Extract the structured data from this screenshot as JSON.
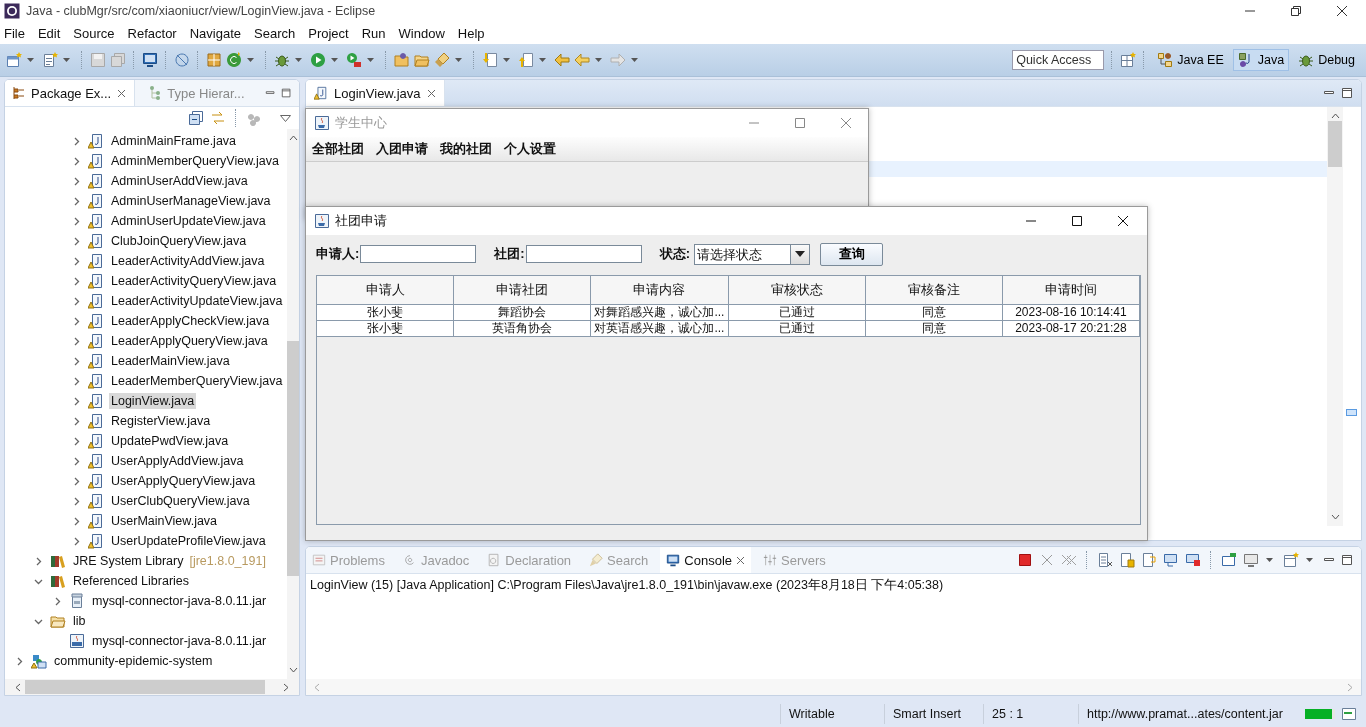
{
  "window": {
    "title": "Java - clubMgr/src/com/xiaoniucr/view/LoginView.java - Eclipse"
  },
  "menu": [
    "File",
    "Edit",
    "Source",
    "Refactor",
    "Navigate",
    "Search",
    "Project",
    "Run",
    "Window",
    "Help"
  ],
  "quick_access": {
    "placeholder": "Quick Access"
  },
  "perspectives": [
    {
      "label": "Java EE",
      "kind": "javaee",
      "selected": false
    },
    {
      "label": "Java",
      "kind": "java",
      "selected": true
    },
    {
      "label": "Debug",
      "kind": "debug",
      "selected": false
    }
  ],
  "package_explorer": {
    "tabs": [
      {
        "label": "Package Ex...",
        "selected": true
      },
      {
        "label": "Type Hierar...",
        "selected": false
      }
    ],
    "tree": [
      {
        "children": [
          {
            "children": [
              {
                "children": [
                  {
                    "label": "AdminMainFrame.java",
                    "kind": "java",
                    "expanded": false,
                    "selected": false
                  },
                  {
                    "label": "AdminMemberQueryView.java",
                    "kind": "java",
                    "expanded": false,
                    "selected": false
                  },
                  {
                    "label": "AdminUserAddView.java",
                    "kind": "java",
                    "expanded": false,
                    "selected": false
                  },
                  {
                    "label": "AdminUserManageView.java",
                    "kind": "java",
                    "expanded": false,
                    "selected": false
                  },
                  {
                    "label": "AdminUserUpdateView.java",
                    "kind": "java",
                    "expanded": false,
                    "selected": false
                  },
                  {
                    "label": "ClubJoinQueryView.java",
                    "kind": "java",
                    "expanded": false,
                    "selected": false
                  },
                  {
                    "label": "LeaderActivityAddView.java",
                    "kind": "java",
                    "expanded": false,
                    "selected": false
                  },
                  {
                    "label": "LeaderActivityQueryView.java",
                    "kind": "java",
                    "expanded": false,
                    "selected": false
                  },
                  {
                    "label": "LeaderActivityUpdateView.java",
                    "kind": "java",
                    "expanded": false,
                    "selected": false
                  },
                  {
                    "label": "LeaderApplyCheckView.java",
                    "kind": "java",
                    "expanded": false,
                    "selected": false
                  },
                  {
                    "label": "LeaderApplyQueryView.java",
                    "kind": "java",
                    "expanded": false,
                    "selected": false
                  },
                  {
                    "label": "LeaderMainView.java",
                    "kind": "java",
                    "expanded": false,
                    "selected": false
                  },
                  {
                    "label": "LeaderMemberQueryView.java",
                    "kind": "java",
                    "expanded": false,
                    "selected": false
                  },
                  {
                    "label": "LoginView.java",
                    "kind": "java",
                    "expanded": false,
                    "selected": true
                  },
                  {
                    "label": "RegisterView.java",
                    "kind": "java",
                    "expanded": false,
                    "selected": false
                  },
                  {
                    "label": "UpdatePwdView.java",
                    "kind": "java",
                    "expanded": false,
                    "selected": false
                  },
                  {
                    "label": "UserApplyAddView.java",
                    "kind": "java",
                    "expanded": false,
                    "selected": false
                  },
                  {
                    "label": "UserApplyQueryView.java",
                    "kind": "java",
                    "expanded": false,
                    "selected": false
                  },
                  {
                    "label": "UserClubQueryView.java",
                    "kind": "java",
                    "expanded": false,
                    "selected": false
                  },
                  {
                    "label": "UserMainView.java",
                    "kind": "java",
                    "expanded": false,
                    "selected": false
                  },
                  {
                    "label": "UserUpdateProfileView.java",
                    "kind": "java",
                    "expanded": false,
                    "selected": false
                  }
                ]
              }
            ]
          },
          {
            "label": "JRE System Library",
            "decoration": "[jre1.8.0_191]",
            "kind": "library",
            "expanded": false,
            "selected": false
          },
          {
            "label": "Referenced Libraries",
            "kind": "library",
            "expanded": true,
            "selected": false,
            "children": [
              {
                "label": "mysql-connector-java-8.0.11.jar",
                "kind": "jar",
                "expanded": false,
                "selected": false
              }
            ]
          },
          {
            "label": "lib",
            "kind": "folder",
            "expanded": true,
            "selected": false,
            "children": [
              {
                "label": "mysql-connector-java-8.0.11.jar",
                "kind": "archive",
                "selected": false
              }
            ]
          }
        ]
      },
      {
        "label": "community-epidemic-system",
        "kind": "project",
        "expanded": false,
        "selected": false
      }
    ]
  },
  "editor": {
    "tabs": [
      {
        "label": "LoginView.java",
        "selected": true
      }
    ]
  },
  "student_center_window": {
    "title": "学生中心",
    "menu": [
      "全部社团",
      "入团申请",
      "我的社团",
      "个人设置"
    ]
  },
  "apply_window": {
    "title": "社团申请",
    "filters": [
      {
        "label": "申请人:",
        "kind": "text"
      },
      {
        "label": "社团:",
        "kind": "text"
      },
      {
        "label": "状态:",
        "kind": "combo",
        "value": "请选择状态"
      }
    ],
    "button": "查询",
    "table": {
      "columns": [
        "申请人",
        "申请社团",
        "申请内容",
        "审核状态",
        "审核备注",
        "申请时间"
      ],
      "rows": [
        [
          "张小斐",
          "舞蹈协会",
          "对舞蹈感兴趣，诚心加...",
          "已通过",
          "同意",
          "2023-08-16 10:14:41"
        ],
        [
          "张小斐",
          "英语角协会",
          "对英语感兴趣，诚心加...",
          "已通过",
          "同意",
          "2023-08-17 20:21:28"
        ]
      ]
    }
  },
  "bottom_panel": {
    "tabs": [
      {
        "label": "Problems",
        "kind": "problems",
        "selected": false
      },
      {
        "label": "Javadoc",
        "kind": "javadoc",
        "selected": false
      },
      {
        "label": "Declaration",
        "kind": "declaration",
        "selected": false
      },
      {
        "label": "Search",
        "kind": "search",
        "selected": false
      },
      {
        "label": "Console",
        "kind": "console",
        "selected": true
      },
      {
        "label": "Servers",
        "kind": "servers",
        "selected": false
      }
    ],
    "console_line": "LoginView (15) [Java Application] C:\\Program Files\\Java\\jre1.8.0_191\\bin\\javaw.exe (2023年8月18日 下午4:05:38)"
  },
  "status_bar": {
    "mode": "Writable",
    "insert_mode": "Smart Insert",
    "position": "25 : 1",
    "task": "http://www.pramat...ates/content.jar",
    "progress": {
      "level": 0.9
    }
  }
}
